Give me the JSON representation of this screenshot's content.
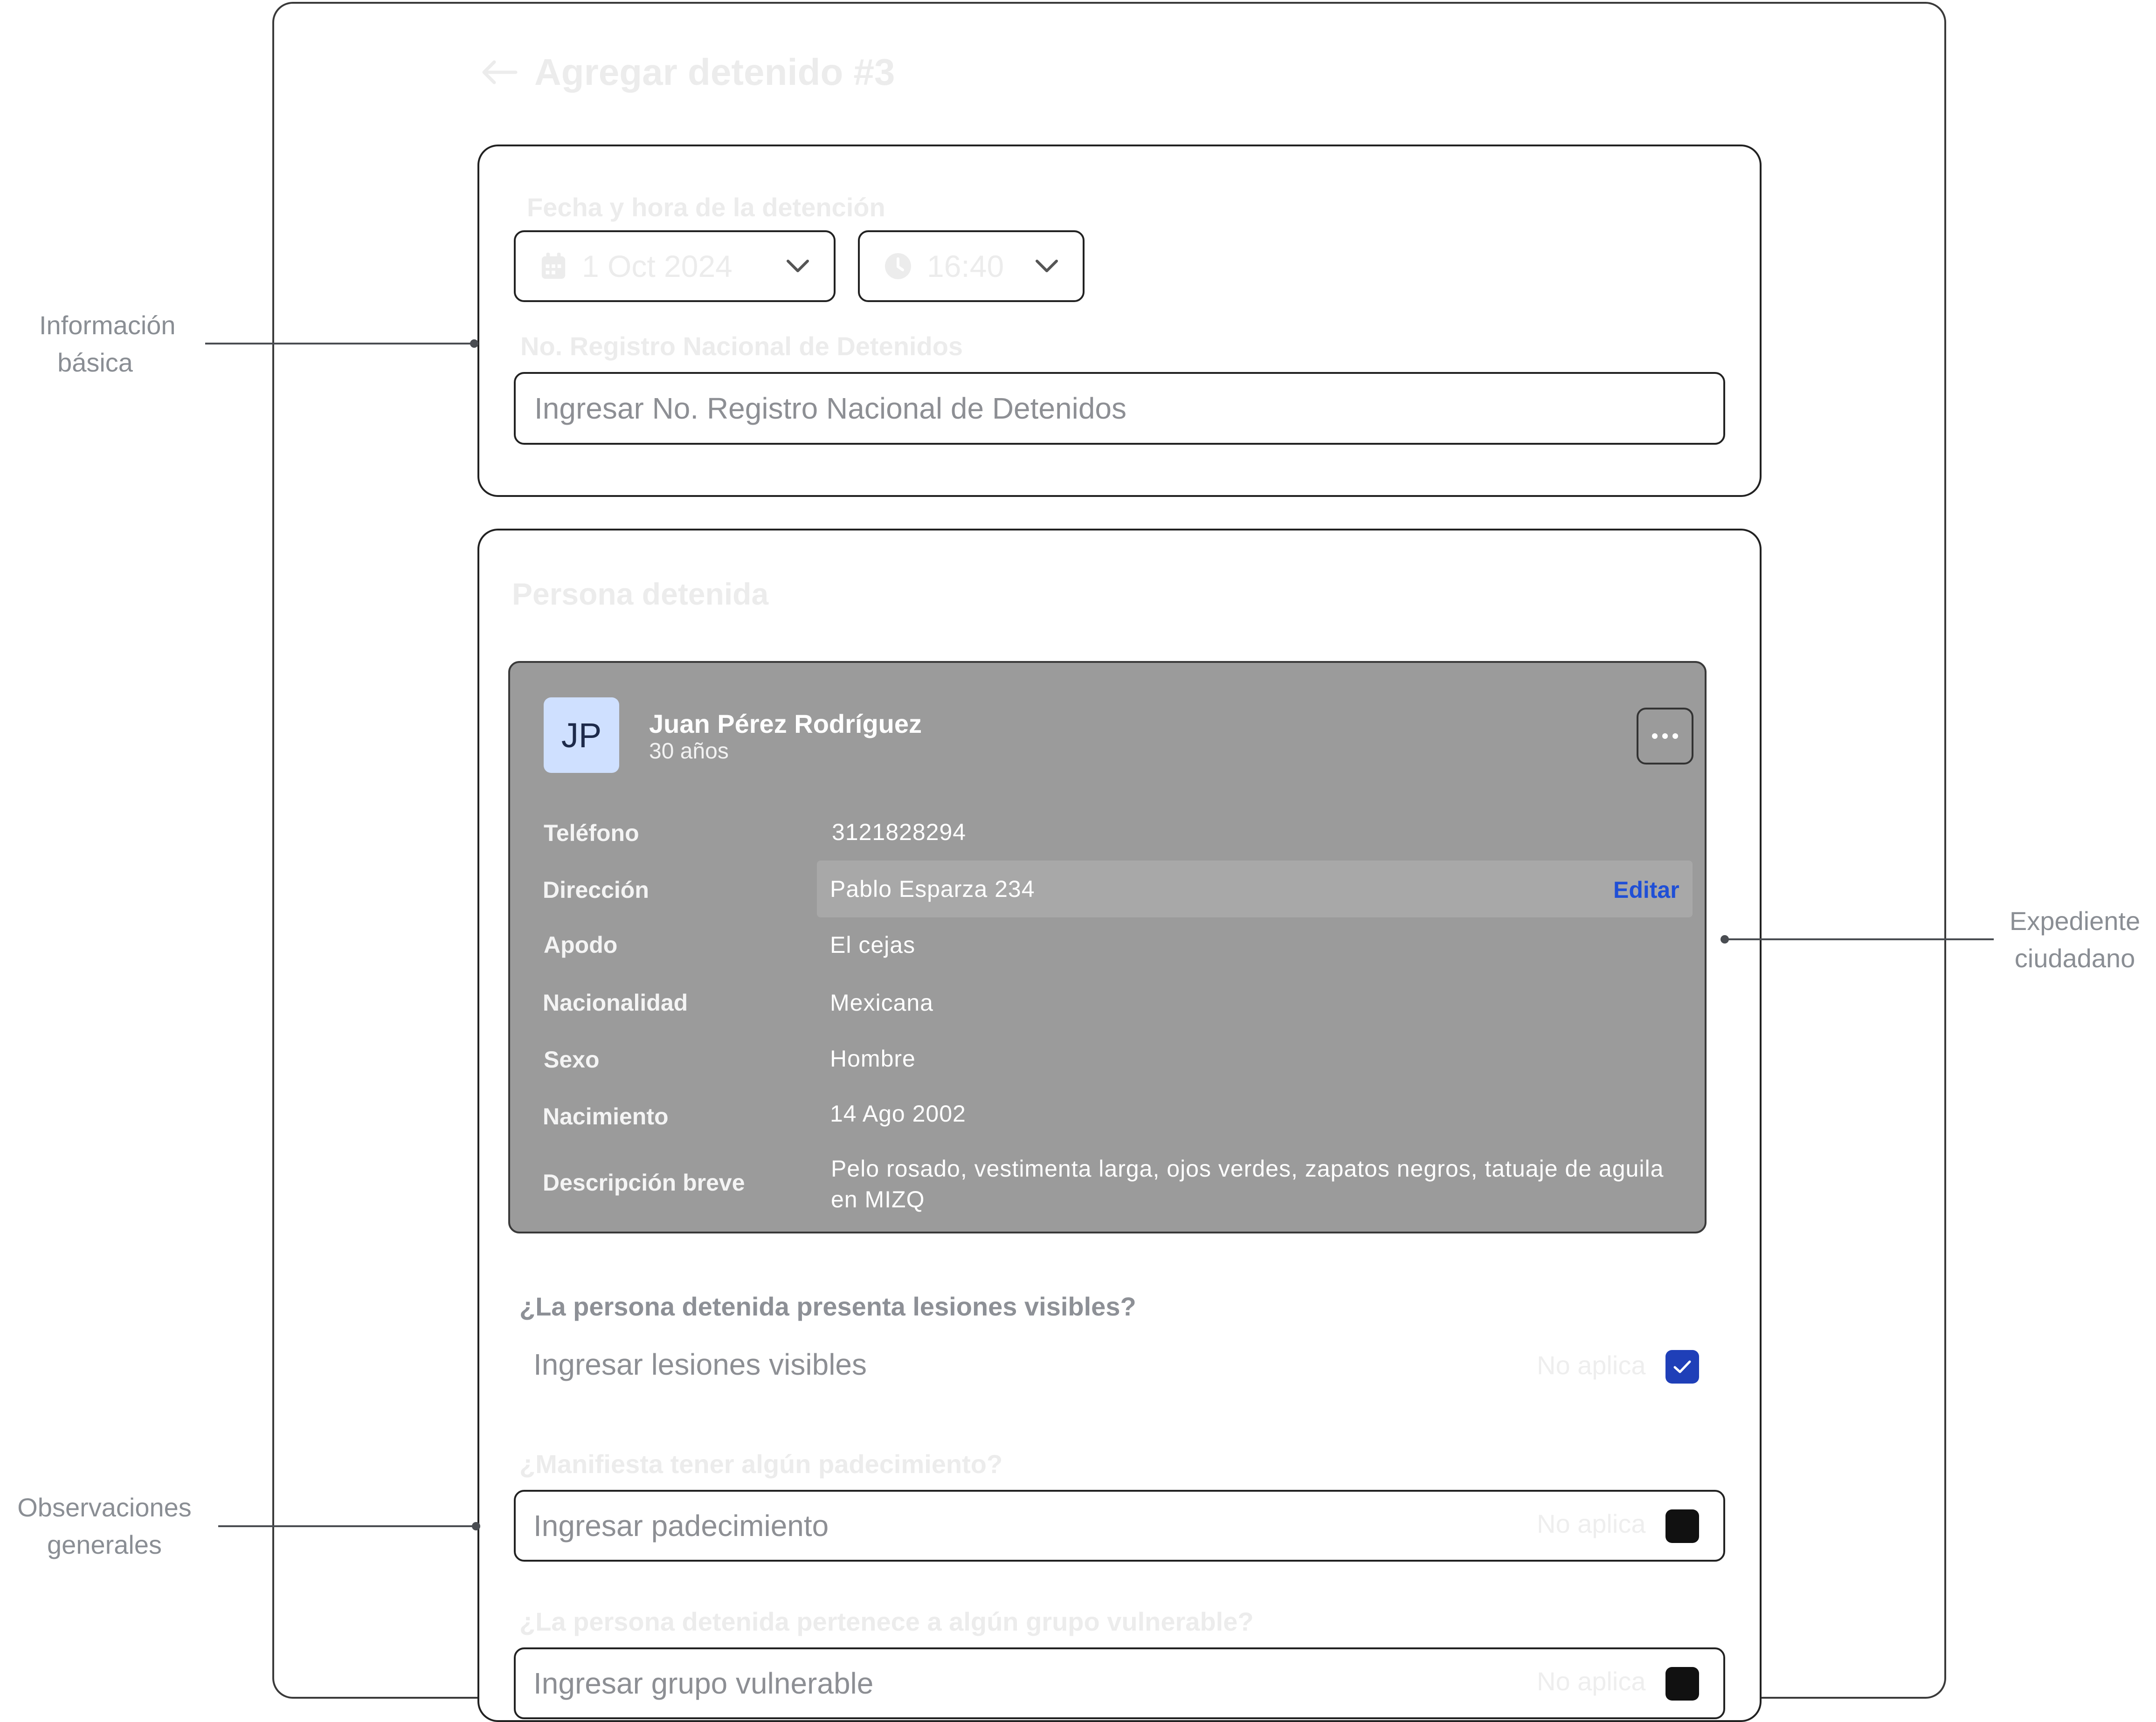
{
  "header": {
    "title": "Agregar detenido #3",
    "back_icon": "arrow-left-icon"
  },
  "basic_info": {
    "date_time_label": "Fecha y hora de la detención",
    "date_value": "1 Oct 2024",
    "time_value": "16:40",
    "registry_label": "No. Registro Nacional de Detenidos",
    "registry_placeholder": "Ingresar No. Registro Nacional de Detenidos"
  },
  "detainee": {
    "section_title": "Persona detenida",
    "initials": "JP",
    "name": "Juan Pérez Rodríguez",
    "age": "30 años",
    "more_icon": "more-horizontal-icon",
    "rows": [
      {
        "label": "Teléfono",
        "value": "3121828294"
      },
      {
        "label": "Dirección",
        "value": "Pablo Esparza 234",
        "action": "Editar"
      },
      {
        "label": "Apodo",
        "value": "El cejas"
      },
      {
        "label": "Nacionalidad",
        "value": "Mexicana"
      },
      {
        "label": "Sexo",
        "value": "Hombre"
      },
      {
        "label": "Nacimiento",
        "value": "14 Ago 2002"
      },
      {
        "label": "Descripción breve",
        "value": "Pelo rosado, vestimenta larga, ojos verdes, zapatos negros, tatuaje de aguila en MIZQ"
      }
    ]
  },
  "observations": {
    "injuries": {
      "question": "¿La persona detenida presenta lesiones visibles?",
      "placeholder": "Ingresar lesiones visibles",
      "na_label": "No aplica",
      "checked": true
    },
    "condition": {
      "question": "¿Manifiesta tener algún padecimiento?",
      "placeholder": "Ingresar padecimiento",
      "na_label": "No aplica",
      "checked": false
    },
    "vulnerable": {
      "question": "¿La persona detenida pertenece a algún grupo vulnerable?",
      "placeholder": "Ingresar grupo vulnerable",
      "na_label": "No aplica",
      "checked": false
    }
  },
  "annotations": {
    "basic": "Información básica",
    "record": "Expediente ciudadano",
    "general": "Observaciones generales"
  },
  "colors": {
    "accent": "#1f4fd6",
    "checkbox_checked": "#1f3fb8",
    "profile_bg": "#9b9b9b"
  }
}
